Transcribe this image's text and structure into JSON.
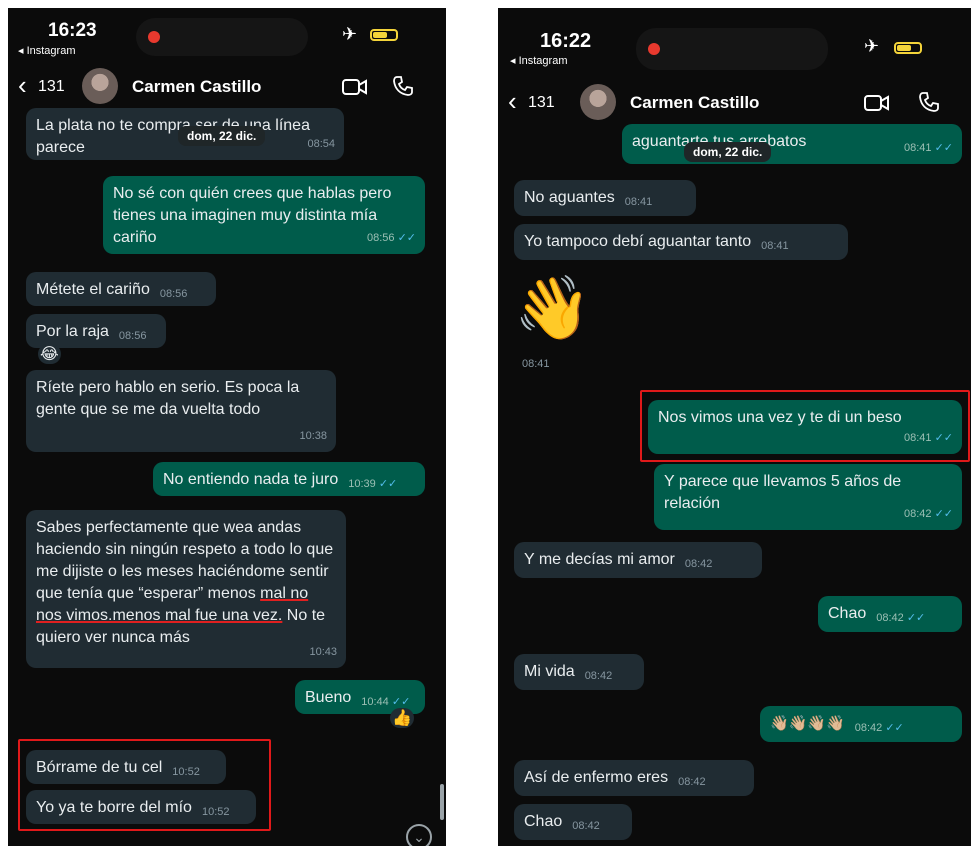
{
  "colors": {
    "incoming_bubble": "#202c33",
    "outgoing_bubble": "#005c4b",
    "read_tick": "#53bdeb",
    "highlight_box": "#e0191a"
  },
  "left": {
    "status": {
      "time": "16:23",
      "back_app": "◂ Instagram"
    },
    "header": {
      "back_count": "131",
      "contact_name": "Carmen Castillo"
    },
    "date_pill": "dom, 22 dic.",
    "messages": [
      {
        "dir": "in",
        "text": "La plata no te compra ser de una línea parece",
        "time": "08:54"
      },
      {
        "dir": "out",
        "text": "No sé con quién crees que hablas pero tienes una imaginen muy distinta mía cariño",
        "time": "08:56",
        "tick": "✓✓"
      },
      {
        "dir": "in",
        "text": "Métete el cariño",
        "time": "08:56"
      },
      {
        "dir": "in",
        "text": "Por la raja",
        "time": "08:56",
        "reaction": "😂"
      },
      {
        "dir": "in",
        "text": "Ríete pero hablo en serio. Es poca la gente que se me da vuelta todo",
        "time": "10:38"
      },
      {
        "dir": "out",
        "text": "No entiendo nada te juro",
        "time": "10:39",
        "tick": "✓✓"
      },
      {
        "dir": "in",
        "text_part1": "Sabes perfectamente que wea andas haciendo sin ningún respeto a todo lo que me dijiste o les meses haciéndome sentir que tenía que “esperar” menos",
        "text_underlined": "mal no nos vimos.menos mal fue una vez.",
        "text_part2": " No te quiero ver nunca más",
        "time": "10:43"
      },
      {
        "dir": "out",
        "text": "Bueno",
        "time": "10:44",
        "tick": "✓✓",
        "reaction": "👍"
      },
      {
        "dir": "in",
        "text": "Bórrame de tu cel",
        "time": "10:52"
      },
      {
        "dir": "in",
        "text": "Yo ya te borre del mío",
        "time": "10:52"
      }
    ],
    "scroll_down_glyph": "⌄"
  },
  "right": {
    "status": {
      "time": "16:22",
      "back_app": "◂ Instagram"
    },
    "header": {
      "back_count": "131",
      "contact_name": "Carmen Castillo"
    },
    "date_pill": "dom, 22 dic.",
    "messages": [
      {
        "dir": "out",
        "text": "aguantarte tus arrebatos",
        "time": "08:41",
        "tick": "✓✓"
      },
      {
        "dir": "in",
        "text": "No aguantes",
        "time": "08:41"
      },
      {
        "dir": "in",
        "text": "Yo tampoco debí aguantar tanto",
        "time": "08:41"
      },
      {
        "dir": "in",
        "emoji": "👋",
        "time": "08:41"
      },
      {
        "dir": "out",
        "text": "Nos vimos una vez y te di un beso",
        "time": "08:41",
        "tick": "✓✓"
      },
      {
        "dir": "out",
        "text": "Y parece que llevamos 5 años de relación",
        "time": "08:42",
        "tick": "✓✓"
      },
      {
        "dir": "in",
        "text": "Y me decías mi amor",
        "time": "08:42"
      },
      {
        "dir": "out",
        "text": "Chao",
        "time": "08:42",
        "tick": "✓✓"
      },
      {
        "dir": "in",
        "text": "Mi vida",
        "time": "08:42"
      },
      {
        "dir": "out",
        "text": "👋🏼👋🏼👋🏼👋🏼",
        "time": "08:42",
        "tick": "✓✓"
      },
      {
        "dir": "in",
        "text": "Así de enfermo eres",
        "time": "08:42"
      },
      {
        "dir": "in",
        "text": "Chao",
        "time": "08:42"
      }
    ]
  }
}
